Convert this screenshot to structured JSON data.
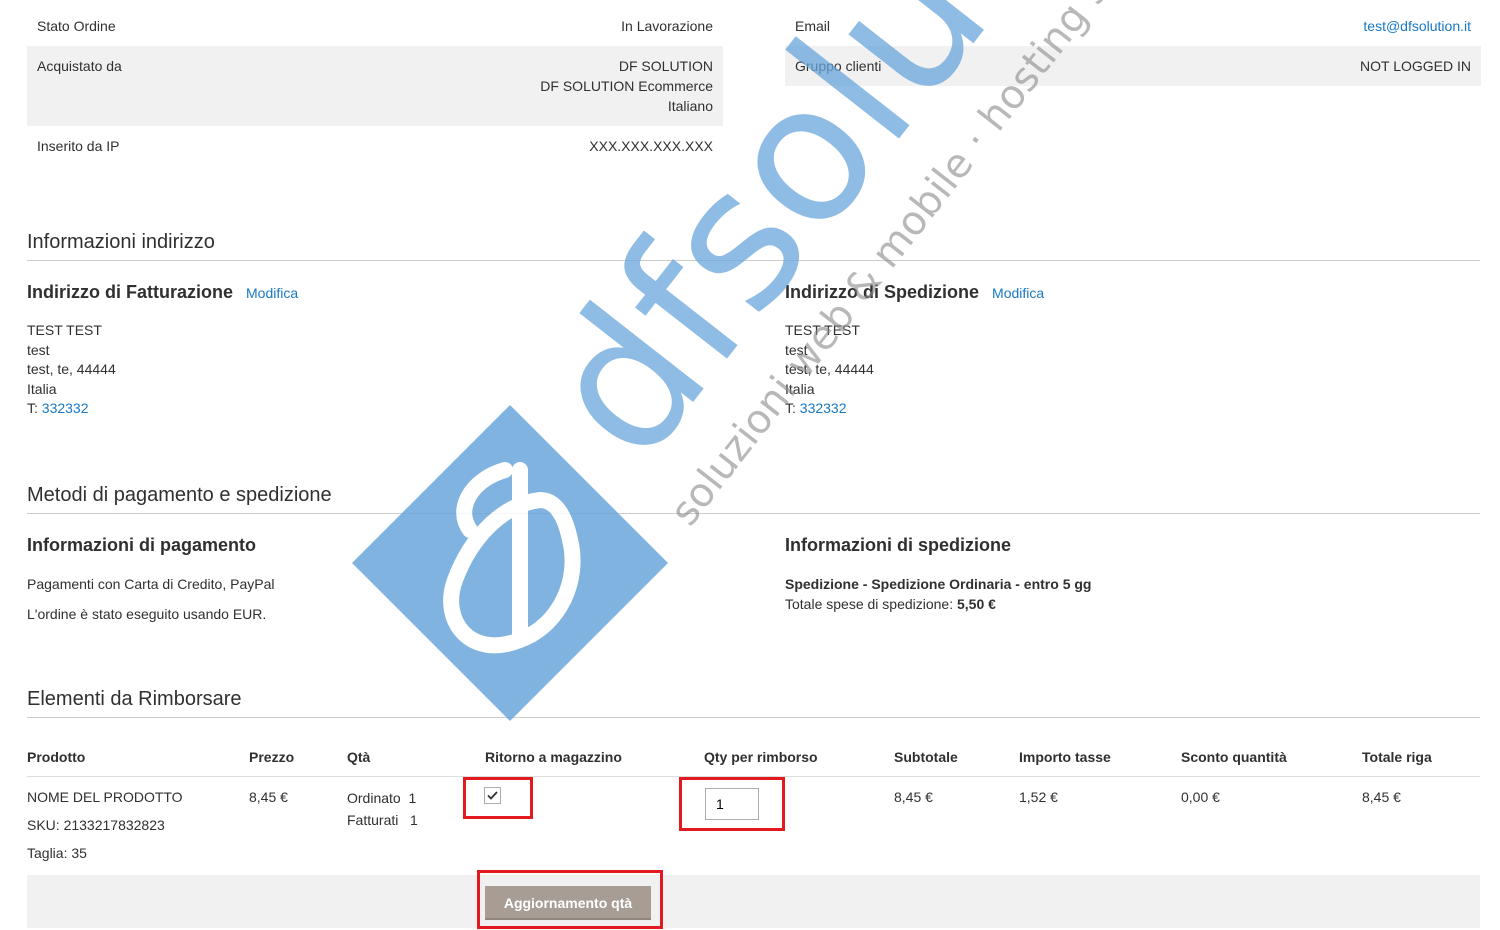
{
  "order_info": {
    "rows": [
      {
        "label": "Stato Ordine",
        "value_lines": [
          "In Lavorazione"
        ]
      },
      {
        "label": "Acquistato da",
        "value_lines": [
          "DF SOLUTION",
          "DF SOLUTION Ecommerce",
          "Italiano"
        ]
      },
      {
        "label": "Inserito da IP",
        "value_lines": [
          "XXX.XXX.XXX.XXX"
        ]
      }
    ]
  },
  "account_info": {
    "email_label": "Email",
    "email_value": "test@dfsolution.it",
    "group_label": "Gruppo clienti",
    "group_value": "NOT LOGGED IN"
  },
  "address_section": {
    "title": "Informazioni indirizzo",
    "billing": {
      "title": "Indirizzo di Fatturazione",
      "edit_label": "Modifica",
      "lines": [
        "TEST TEST",
        "test",
        "test, te, 44444",
        "Italia"
      ],
      "phone_prefix": "T: ",
      "phone": "332332"
    },
    "shipping": {
      "title": "Indirizzo di Spedizione",
      "edit_label": "Modifica",
      "lines": [
        "TEST TEST",
        "test",
        "test, te, 44444",
        "Italia"
      ],
      "phone_prefix": "T: ",
      "phone": "332332"
    }
  },
  "payment_section": {
    "title": "Metodi di pagamento e spedizione",
    "payment": {
      "title": "Informazioni di pagamento",
      "method": "Pagamenti con Carta di Credito, PayPal",
      "currency_note": "L'ordine è stato eseguito usando EUR."
    },
    "shipping": {
      "title": "Informazioni di spedizione",
      "method": "Spedizione - Spedizione Ordinaria - entro 5 gg",
      "total_label": "Totale spese di spedizione: ",
      "total_value": "5,50 €"
    }
  },
  "refund_section": {
    "title": "Elementi da Rimborsare",
    "columns": [
      "Prodotto",
      "Prezzo",
      "Qtà",
      "Ritorno a magazzino",
      "Qty per rimborso",
      "Subtotale",
      "Importo tasse",
      "Sconto quantità",
      "Totale riga"
    ],
    "item": {
      "name": "NOME DEL PRODOTTO",
      "sku": "SKU: 2133217832823",
      "size": "Taglia: 35",
      "price": "8,45 €",
      "ordered_label": "Ordinato",
      "ordered_qty": "1",
      "invoiced_label": "Fatturati",
      "invoiced_qty": "1",
      "return_to_stock": true,
      "refund_qty": "1",
      "subtotal": "8,45 €",
      "tax": "1,52 €",
      "discount": "0,00 €",
      "row_total": "8,45 €"
    },
    "update_button": "Aggiornamento qtà"
  },
  "watermark": {
    "brand_text": "dfsolution",
    "tagline": "soluzioni web & mobile · hosting servi",
    "colors": {
      "blue": "#6aa6db",
      "grey": "#8a8a8a"
    }
  },
  "colors": {
    "link": "#1979c3",
    "highlight": "#e2191f",
    "button": "#a79d95",
    "row_shade": "#f1f1f1"
  }
}
